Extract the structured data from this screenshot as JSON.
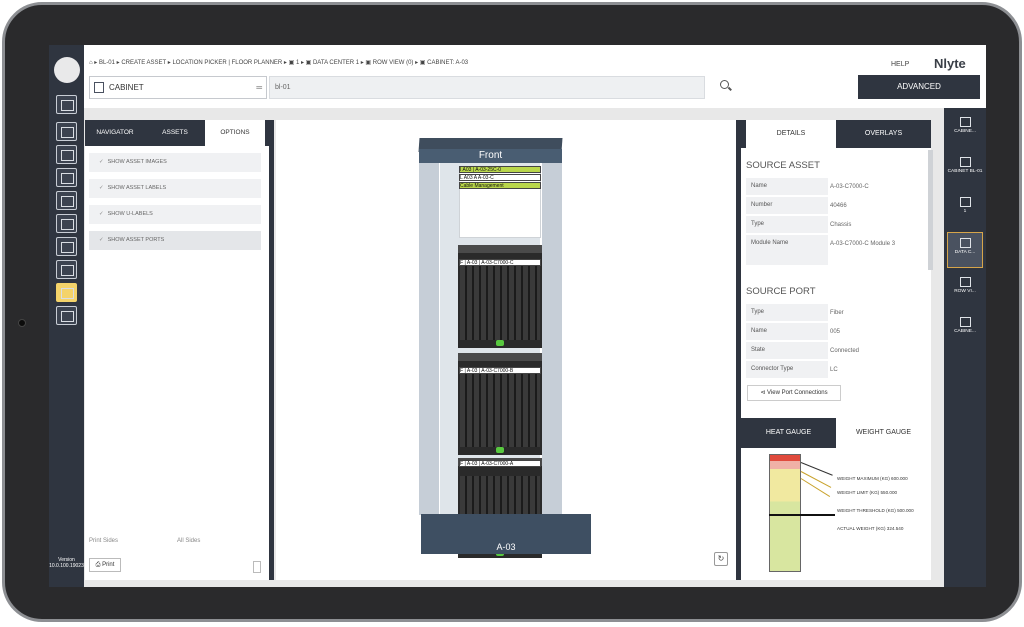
{
  "breadcrumbs": "⌂  ▸ BL-01 ▸ CREATE ASSET ▸ LOCATION PICKER | FLOOR PLANNER ▸ ▣ 1 ▸ ▣ DATA CENTER 1 ▸ ▣ ROW VIEW (0) ▸ ▣ CABINET: A-03",
  "top": {
    "help": "HELP",
    "brand": "Nlyte",
    "cabinet_select": "CABINET",
    "search_value": "bl-01",
    "advanced": "ADVANCED"
  },
  "version": "Version 10.0.100.19023",
  "left_panel": {
    "tabs": [
      "NAVIGATOR",
      "ASSETS",
      "OPTIONS"
    ],
    "options": [
      "SHOW ASSET IMAGES",
      "SHOW ASSET LABELS",
      "SHOW U-LABELS",
      "SHOW ASSET PORTS"
    ],
    "print_sides": "Print Sides",
    "all_sides": "All Sides",
    "print": "Print"
  },
  "rack": {
    "front": "Front",
    "base_label": "A-03",
    "top_labels": [
      "I A03 | A-03-25C-0",
      "L A03 A A-03-C",
      "Cable Management"
    ],
    "chassis_labels": [
      "F | A-03 | A-03-C7000-C",
      "F | A-03 | A-03-C7000-B",
      "F | A-03 | A-03-C7000-A"
    ]
  },
  "details": {
    "tabs": [
      "DETAILS",
      "OVERLAYS"
    ],
    "source_asset_title": "SOURCE ASSET",
    "source_asset": [
      {
        "k": "Name",
        "v": "A-03-C7000-C"
      },
      {
        "k": "Number",
        "v": "40466"
      },
      {
        "k": "Type",
        "v": "Chassis"
      },
      {
        "k": "Module Name",
        "v": "A-03-C7000-C Module 3"
      }
    ],
    "source_port_title": "SOURCE PORT",
    "source_port": [
      {
        "k": "Type",
        "v": "Fiber"
      },
      {
        "k": "Name",
        "v": "005"
      },
      {
        "k": "State",
        "v": "Connected"
      },
      {
        "k": "Connector Type",
        "v": "LC"
      }
    ],
    "view_connections": "View Port Connections"
  },
  "gauge": {
    "tabs": [
      "HEAT GAUGE",
      "WEIGHT GAUGE"
    ],
    "labels": [
      "WEIGHT MAXIMUM (KG) 600.000",
      "WEIGHT LIMIT (KG) 550.000",
      "WEIGHT THRESHOLD (KG) 500.000",
      "ACTUAL WEIGHT (KG) 324.540"
    ]
  },
  "right_nav": [
    "CABINE...",
    "CABINET BL-01",
    "1",
    "DATA C...",
    "ROW VI...",
    "CABINE..."
  ]
}
